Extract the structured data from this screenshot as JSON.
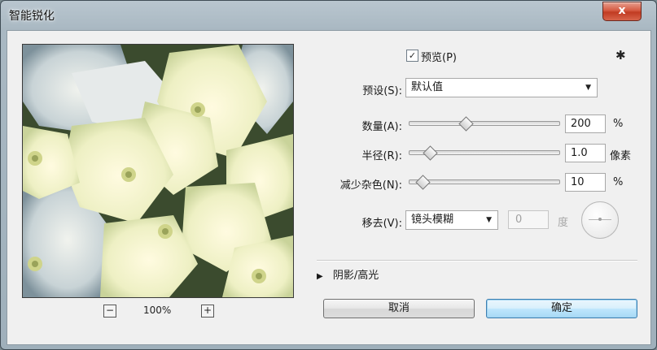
{
  "window": {
    "title": "智能锐化",
    "close_label": "x"
  },
  "preview": {
    "zoom_out_icon": "minus-icon",
    "zoom_out_label": "−",
    "zoom_in_icon": "plus-icon",
    "zoom_in_label": "+",
    "zoom_level": "100%"
  },
  "preview_toggle": {
    "checked": true,
    "check_mark": "✓",
    "label": "预览(P)"
  },
  "settings_icon": {
    "name": "gear-icon",
    "glyph": "✱"
  },
  "preset": {
    "label": "预设(S):",
    "value": "默认值",
    "caret": "▼"
  },
  "amount": {
    "label": "数量(A):",
    "value": "200",
    "unit": "%",
    "slider_fraction": 0.38
  },
  "radius": {
    "label": "半径(R):",
    "value": "1.0",
    "unit": "像素",
    "slider_fraction": 0.14
  },
  "reduce_noise": {
    "label": "减少杂色(N):",
    "value": "10",
    "unit": "%",
    "slider_fraction": 0.09
  },
  "remove": {
    "label": "移去(V):",
    "value": "镜头模糊",
    "caret": "▼",
    "angle_value": "0",
    "angle_unit": "度"
  },
  "shadows_highlights": {
    "label": "阴影/高光",
    "expand_glyph": "▶"
  },
  "buttons": {
    "cancel": "取消",
    "ok": "确定"
  },
  "colors": {
    "window_frame": "#a9b8c2",
    "close_button": "#d65a42",
    "primary_border": "#3c7fb1"
  }
}
